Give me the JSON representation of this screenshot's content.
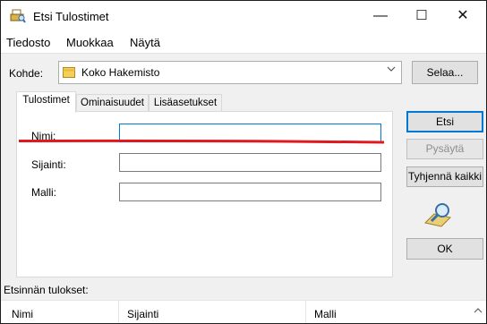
{
  "window": {
    "title": "Etsi Tulostimet",
    "minimize_glyph": "—",
    "maximize_glyph": "☐",
    "close_glyph": "✕"
  },
  "menu": {
    "items": [
      "Tiedosto",
      "Muokkaa",
      "Näytä"
    ]
  },
  "location": {
    "label": "Kohde:",
    "value": "Koko Hakemisto",
    "browse_button": "Selaa..."
  },
  "tabs": [
    {
      "label": "Tulostimet",
      "active": true
    },
    {
      "label": "Ominaisuudet",
      "active": false
    },
    {
      "label": "Lisäasetukset",
      "active": false
    }
  ],
  "fields": {
    "name": {
      "label": "Nimi:",
      "value": ""
    },
    "location": {
      "label": "Sijainti:",
      "value": ""
    },
    "model": {
      "label": "Malli:",
      "value": ""
    }
  },
  "buttons": {
    "search": "Etsi",
    "stop": "Pysäytä",
    "clear_all": "Tyhjennä kaikki",
    "ok": "OK"
  },
  "results": {
    "label": "Etsinnän tulokset:",
    "columns": [
      "Nimi",
      "Sijainti",
      "Malli"
    ]
  },
  "colors": {
    "annotation_underline": "#e0191f",
    "focus_border": "#0078d7"
  },
  "icons": [
    "printer-search-icon",
    "folder-icon",
    "chevron-down-icon",
    "search-magnifier-icon",
    "scroll-up-icon"
  ]
}
